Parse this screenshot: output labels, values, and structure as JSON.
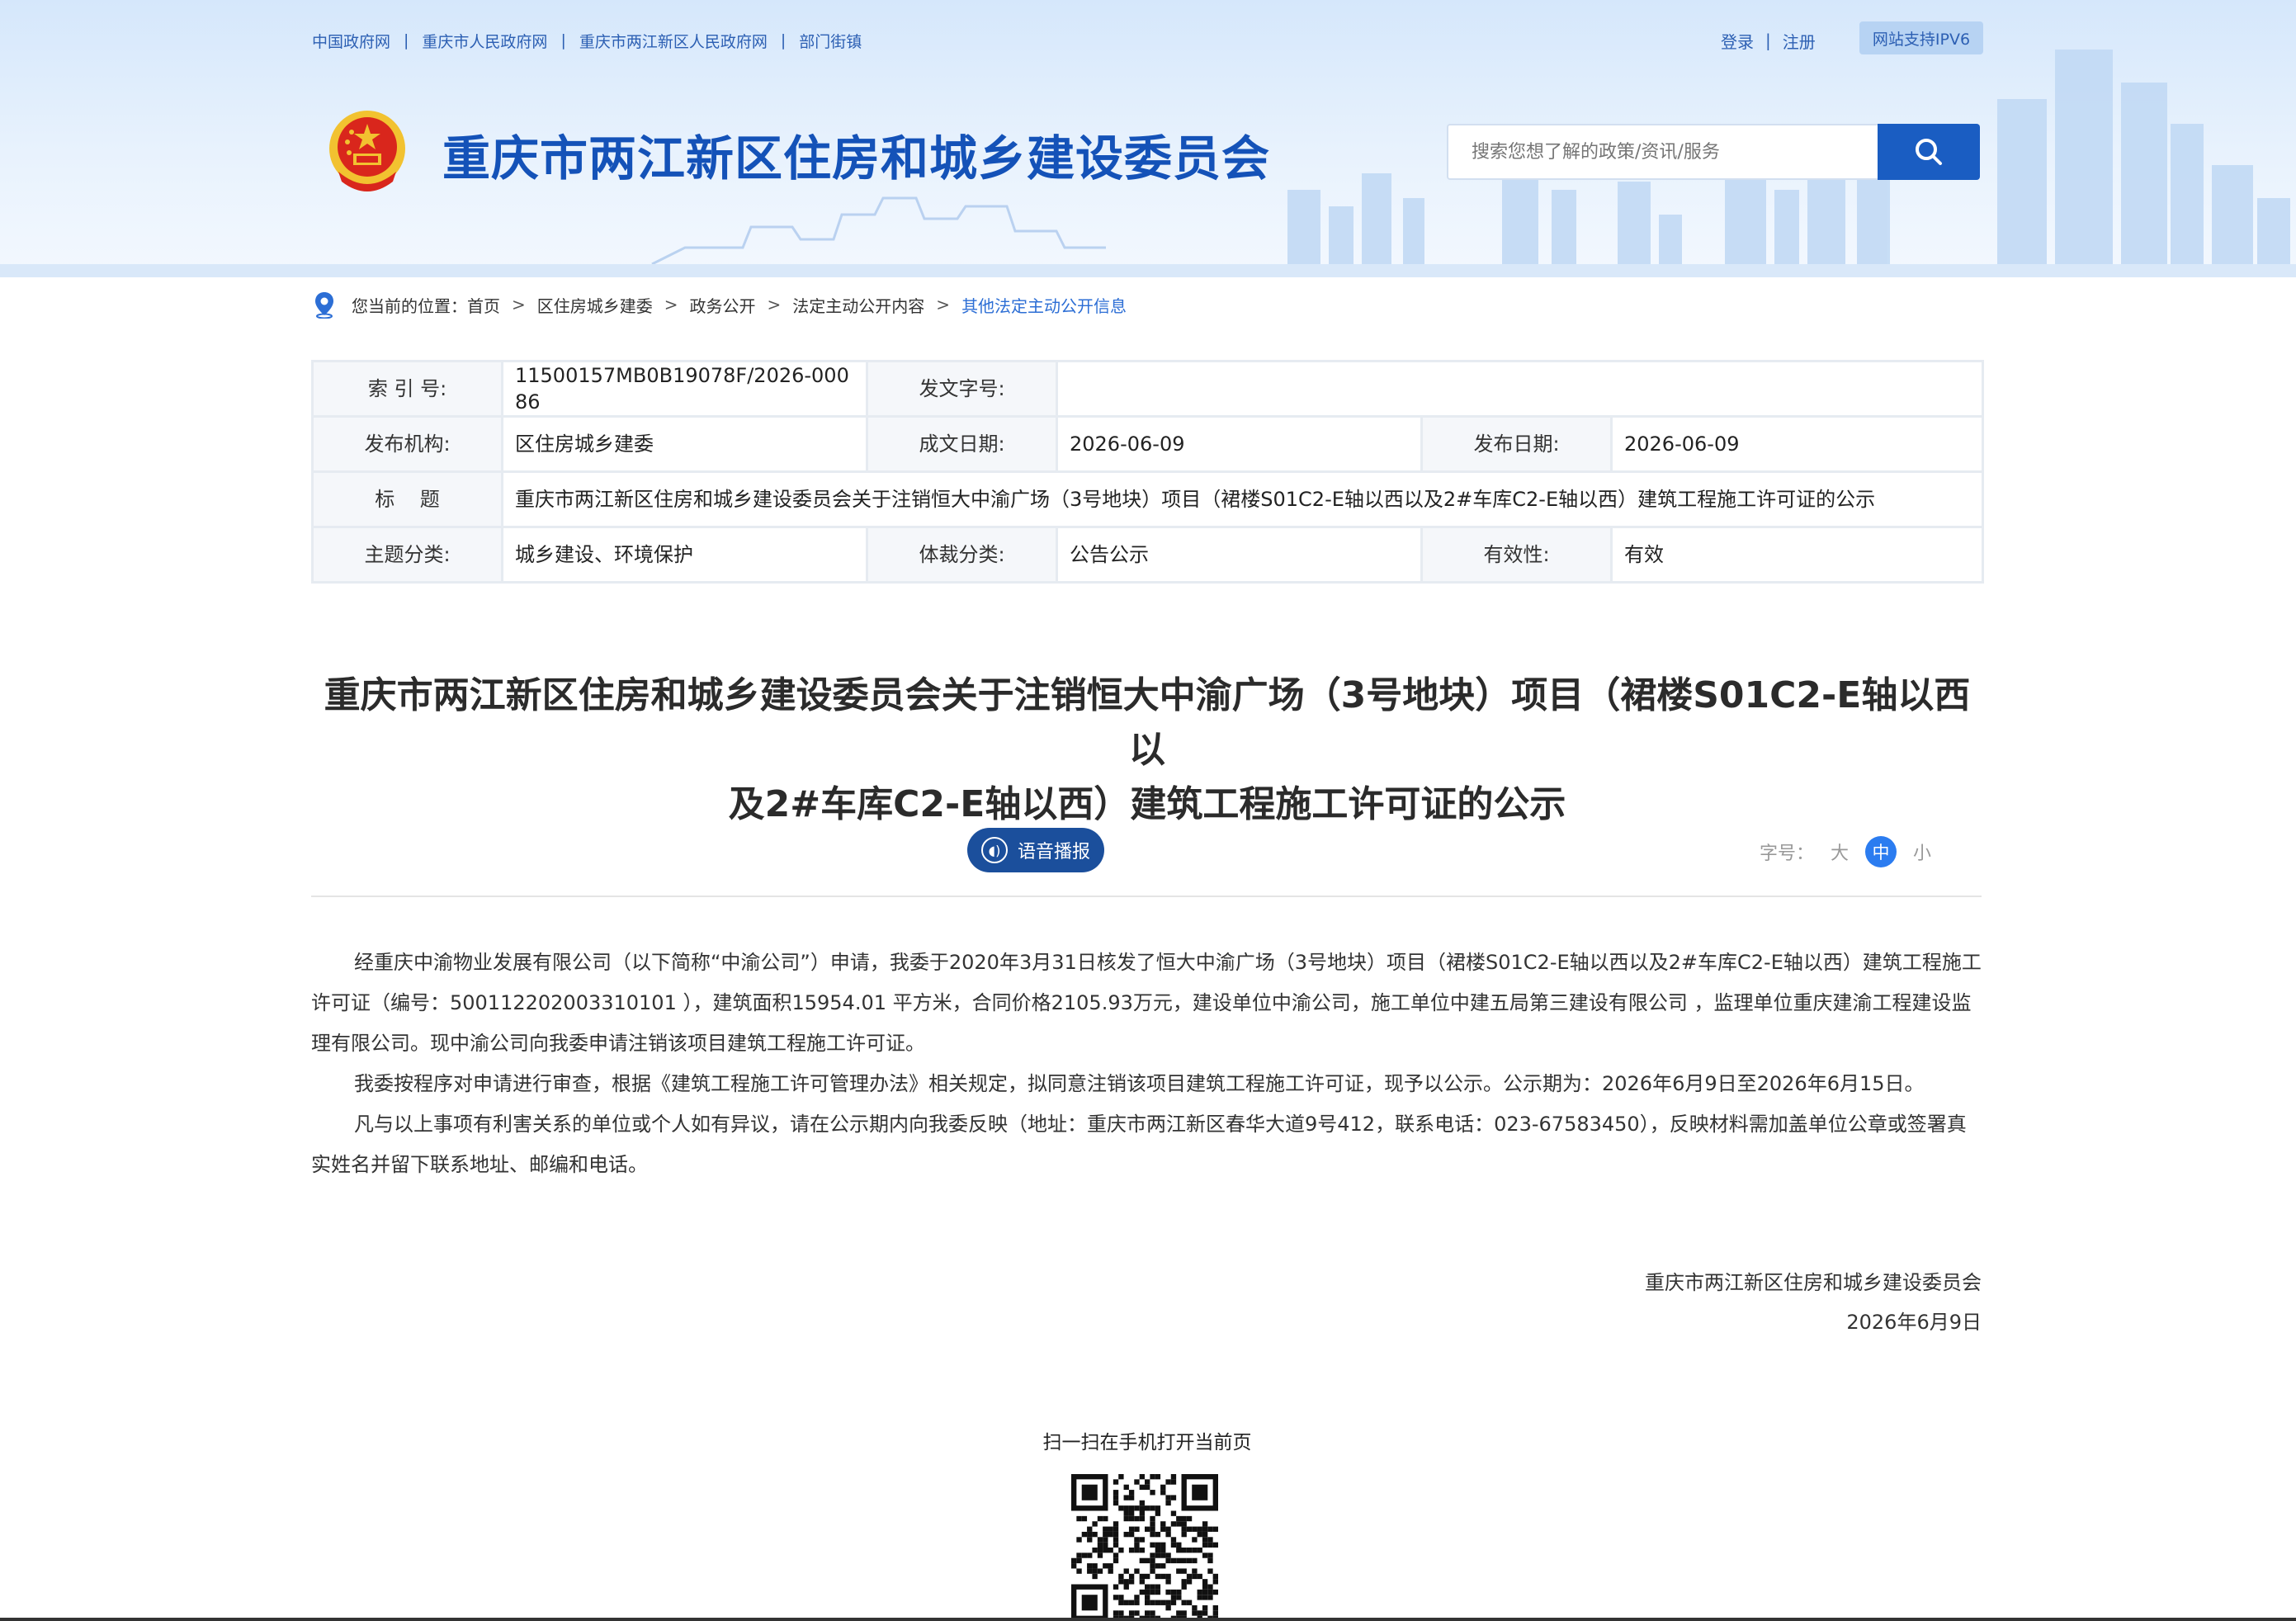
{
  "header": {
    "topnav": [
      "中国政府网",
      "重庆市人民政府网",
      "重庆市两江新区人民政府网",
      "部门街镇"
    ],
    "login": "登录",
    "register": "注册",
    "ipv6_badge": "网站支持IPV6",
    "site_title": "重庆市两江新区住房和城乡建设委员会",
    "search_placeholder": "搜索您想了解的政策/资讯/服务",
    "search_icon": "search-icon",
    "emblem_icon": "national-emblem-icon"
  },
  "breadcrumb": {
    "prefix": "您当前的位置：",
    "items": [
      "首页",
      "区住房城乡建委",
      "政务公开",
      "法定主动公开内容",
      "其他法定主动公开信息"
    ]
  },
  "meta": {
    "index_label": "索 引 号:",
    "index_value": "11500157MB0B19078F/2026-00086",
    "doc_no_label": "发文字号:",
    "doc_no_value": "",
    "publisher_label": "发布机构:",
    "publisher_value": "区住房城乡建委",
    "created_label": "成文日期:",
    "created_value": "2026-06-09",
    "published_label": "发布日期:",
    "published_value": "2026-06-09",
    "title_label": "标    题",
    "title_value": "重庆市两江新区住房和城乡建设委员会关于注销恒大中渝广场（3号地块）项目（裙楼S01C2-E轴以西以及2#车库C2-E轴以西）建筑工程施工许可证的公示",
    "topic_label": "主题分类:",
    "topic_value": "城乡建设、环境保护",
    "genre_label": "体裁分类:",
    "genre_value": "公告公示",
    "validity_label": "有效性:",
    "validity_value": "有效"
  },
  "article": {
    "title_line1": "重庆市两江新区住房和城乡建设委员会关于注销恒大中渝广场（3号地块）项目（裙楼S01C2-E轴以西以",
    "title_line2": "及2#车库C2-E轴以西）建筑工程施工许可证的公示",
    "audio_label": "语音播报",
    "fontsize_label": "字号：",
    "font_large": "大",
    "font_medium": "中",
    "font_small": "小",
    "paragraphs": [
      "经重庆中渝物业发展有限公司（以下简称“中渝公司”）申请，我委于2020年3月31日核发了恒大中渝广场（3号地块）项目（裙楼S01C2-E轴以西以及2#车库C2-E轴以西）建筑工程施工许可证（编号：500112202003310101 ），建筑面积15954.01 平方米，合同价格2105.93万元，建设单位中渝公司，施工单位中建五局第三建设有限公司 ，监理单位重庆建渝工程建设监理有限公司。现中渝公司向我委申请注销该项目建筑工程施工许可证。",
      "我委按程序对申请进行审查，根据《建筑工程施工许可管理办法》相关规定，拟同意注销该项目建筑工程施工许可证，现予以公示。公示期为：2026年6月9日至2026年6月15日。",
      "凡与以上事项有利害关系的单位或个人如有异议，请在公示期内向我委反映（地址：重庆市两江新区春华大道9号412，联系电话：023-67583450），反映材料需加盖单位公章或签署真实姓名并留下联系地址、邮编和电话。"
    ],
    "signature_org": "重庆市两江新区住房和城乡建设委员会",
    "signature_date": "2026年6月9日"
  },
  "qr": {
    "label": "扫一扫在手机打开当前页"
  }
}
